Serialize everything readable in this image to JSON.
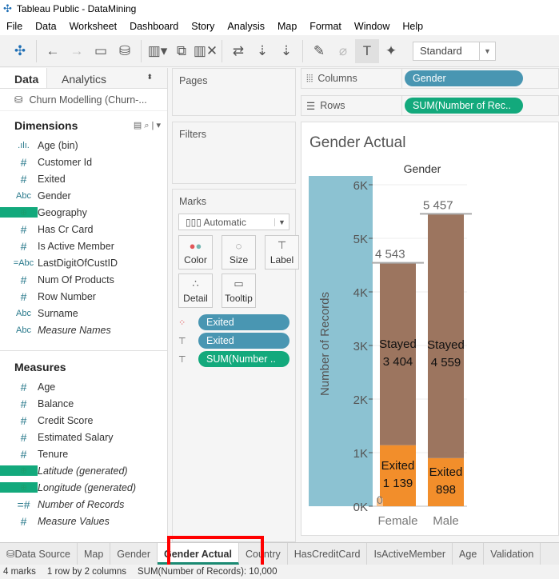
{
  "window": {
    "title": "Tableau Public - DataMining"
  },
  "menu": [
    "File",
    "Data",
    "Worksheet",
    "Dashboard",
    "Story",
    "Analysis",
    "Map",
    "Format",
    "Window",
    "Help"
  ],
  "toolbar": {
    "fit_select": "Standard",
    "icons": [
      "tableau-logo",
      "back",
      "forward",
      "save",
      "new-datasource",
      "new-worksheet",
      "duplicate-sheet",
      "clear-sheet",
      "swap",
      "sort-ascending",
      "sort-descending",
      "highlight",
      "annotate",
      "show-labels",
      "pin"
    ]
  },
  "left_panel": {
    "tabs": [
      "Data",
      "Analytics"
    ],
    "datasource": "Churn Modelling (Churn-...",
    "dimensions_title": "Dimensions",
    "dimensions": [
      {
        "icon": ".ılı.",
        "label": "Age (bin)"
      },
      {
        "icon": "#",
        "label": "Customer Id"
      },
      {
        "icon": "#",
        "label": "Exited"
      },
      {
        "icon": "Abc",
        "label": "Gender"
      },
      {
        "icon": "globe",
        "label": "Geography"
      },
      {
        "icon": "#",
        "label": "Has Cr Card"
      },
      {
        "icon": "#",
        "label": "Is Active Member"
      },
      {
        "icon": "=Abc",
        "label": "LastDigitOfCustID"
      },
      {
        "icon": "#",
        "label": "Num Of Products"
      },
      {
        "icon": "#",
        "label": "Row Number"
      },
      {
        "icon": "Abc",
        "label": "Surname"
      },
      {
        "icon": "Abc",
        "label": "Measure Names",
        "italic": true
      }
    ],
    "measures_title": "Measures",
    "measures": [
      {
        "icon": "#",
        "label": "Age"
      },
      {
        "icon": "#",
        "label": "Balance"
      },
      {
        "icon": "#",
        "label": "Credit Score"
      },
      {
        "icon": "#",
        "label": "Estimated Salary"
      },
      {
        "icon": "#",
        "label": "Tenure"
      },
      {
        "icon": "globe",
        "label": "Latitude (generated)",
        "italic": true
      },
      {
        "icon": "globe",
        "label": "Longitude (generated)",
        "italic": true
      },
      {
        "icon": "=#",
        "label": "Number of Records",
        "italic": true
      },
      {
        "icon": "#",
        "label": "Measure Values",
        "italic": true
      }
    ]
  },
  "cards": {
    "pages": "Pages",
    "filters": "Filters",
    "marks": "Marks",
    "mark_type": "Automatic",
    "buttons": [
      "Color",
      "Size",
      "Label",
      "Detail",
      "Tooltip"
    ],
    "pills": [
      {
        "icon": "color",
        "label": "Exited"
      },
      {
        "icon": "label",
        "label": "Exited"
      },
      {
        "icon": "label",
        "label": "SUM(Number .."
      }
    ]
  },
  "shelves": {
    "columns_label": "Columns",
    "columns_pill": "Gender",
    "rows_label": "Rows",
    "rows_pill": "SUM(Number of Rec.."
  },
  "chart_data": {
    "type": "bar",
    "stacked": true,
    "title": "Gender Actual",
    "column_header": "Gender",
    "ylabel": "Number of Records",
    "ylim": [
      0,
      6000
    ],
    "yticks": [
      "0K",
      "1K",
      "2K",
      "3K",
      "4K",
      "5K",
      "6K"
    ],
    "categories": [
      "Female",
      "Male"
    ],
    "series": [
      {
        "name": "Exited",
        "values": [
          1139,
          898
        ],
        "color": "#f28e2b"
      },
      {
        "name": "Stayed",
        "values": [
          3404,
          4559
        ],
        "color": "#9c755f"
      }
    ],
    "totals": [
      "4 543",
      "5 457"
    ],
    "segment_labels": [
      [
        "Exited",
        "1 139"
      ],
      [
        "Exited",
        "898"
      ],
      [
        "Stayed",
        "3 404"
      ],
      [
        "Stayed",
        "4 559"
      ]
    ],
    "extra_label": "0",
    "axis_band_color": "#8cc2d2"
  },
  "sheet_tabs": [
    "Data Source",
    "Map",
    "Gender",
    "Gender Actual",
    "Country",
    "HasCreditCard",
    "IsActiveMember",
    "Age",
    "Validation"
  ],
  "active_tab": "Gender Actual",
  "status": {
    "marks": "4 marks",
    "dims": "1 row by 2 columns",
    "sum": "SUM(Number of Records): 10,000"
  }
}
